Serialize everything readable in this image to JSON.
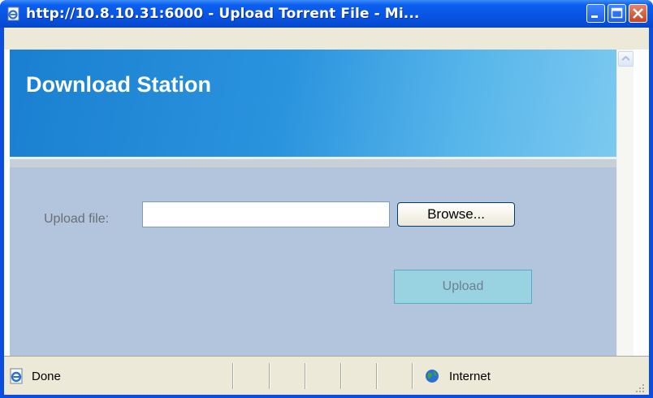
{
  "window": {
    "title": "http://10.8.10.31:6000 - Upload Torrent File - Mi...",
    "icons": {
      "app": "ie-document-icon",
      "minimize": "minimize-icon",
      "maximize": "maximize-icon",
      "close": "close-icon"
    }
  },
  "page": {
    "banner_title": "Download Station",
    "upload": {
      "label": "Upload file:",
      "file_value": "",
      "browse_label": "Browse...",
      "submit_label": "Upload"
    }
  },
  "statusbar": {
    "status_text": "Done",
    "zone_text": "Internet",
    "icons": {
      "page": "ie-page-icon",
      "zone": "globe-icon",
      "resize": "resize-grip-icon"
    }
  },
  "colors": {
    "titlebar": "#0a5ff0",
    "page_background": "#b3c4dd",
    "banner": "#2a93de",
    "upload_button": "#99d3e1"
  }
}
